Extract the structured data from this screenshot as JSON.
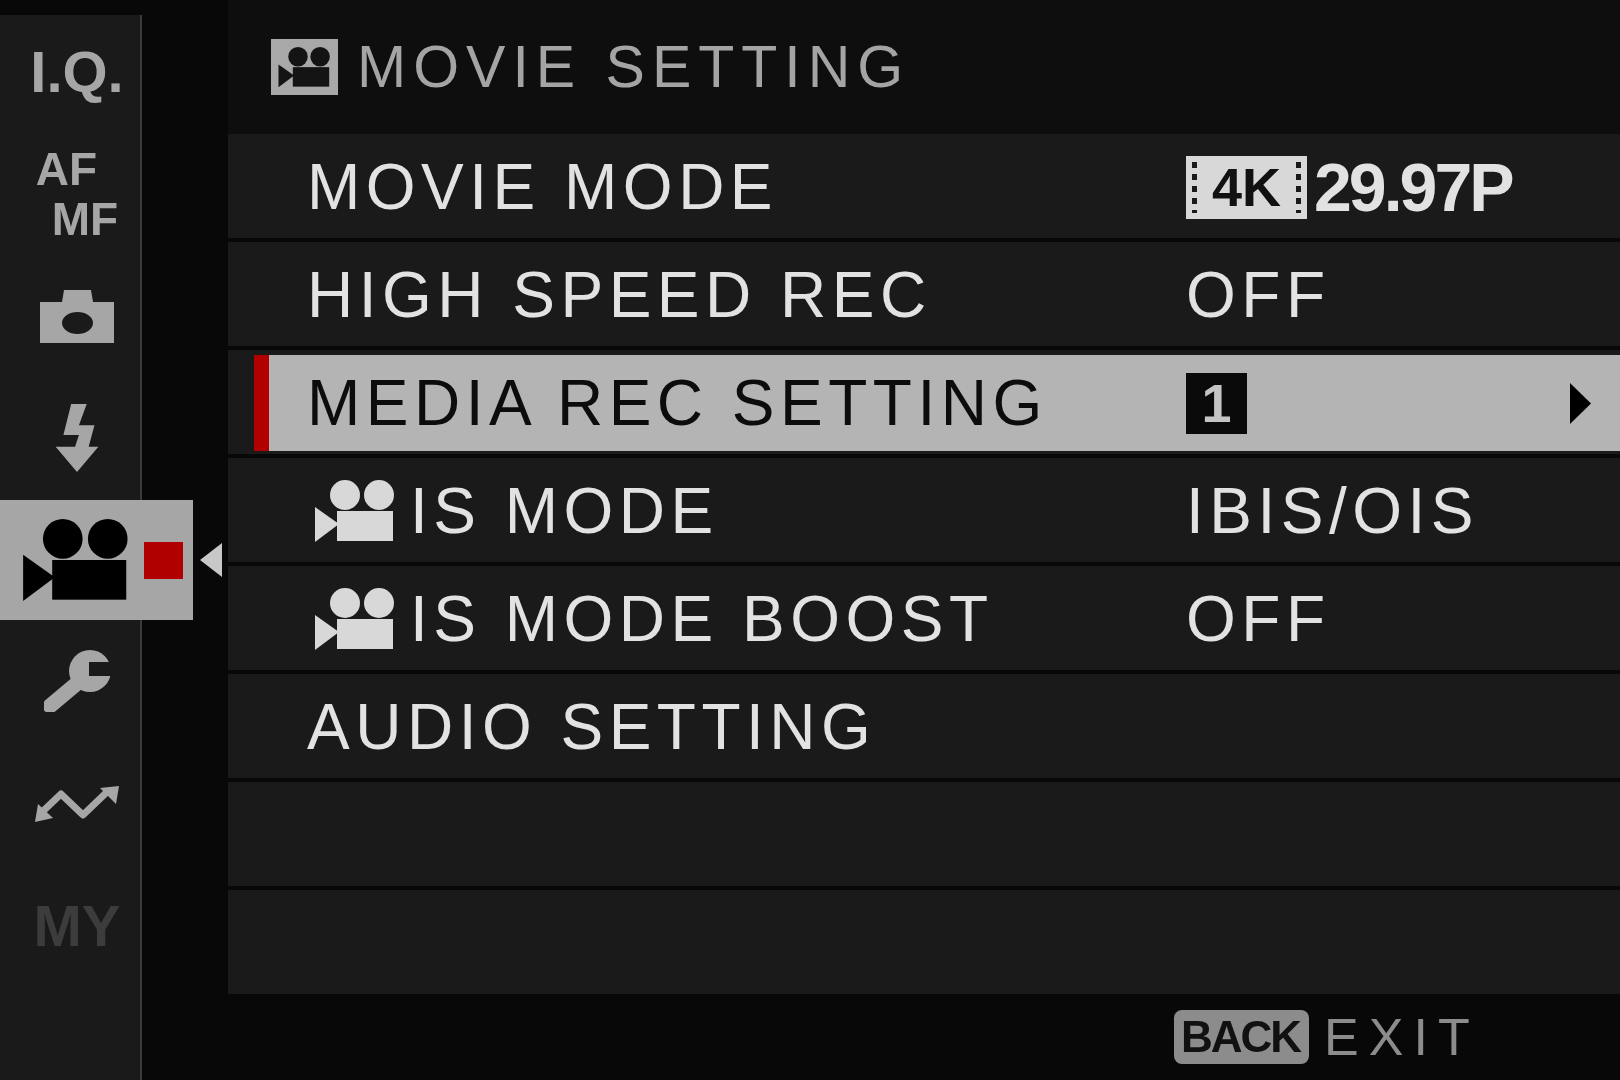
{
  "sidebar": {
    "items": [
      {
        "kind": "text",
        "label": "I.Q.",
        "selected": false,
        "disabled": false
      },
      {
        "kind": "stack",
        "label": "AF",
        "sublabel": "MF",
        "selected": false,
        "disabled": false
      },
      {
        "kind": "icon",
        "selected": false,
        "disabled": false
      },
      {
        "kind": "icon",
        "selected": false,
        "disabled": false
      },
      {
        "kind": "icon",
        "selected": true,
        "disabled": false
      },
      {
        "kind": "icon",
        "selected": false,
        "disabled": false
      },
      {
        "kind": "icon",
        "selected": false,
        "disabled": false
      },
      {
        "kind": "text",
        "label": "MY",
        "selected": false,
        "disabled": true
      }
    ]
  },
  "header": {
    "title": "MOVIE SETTING"
  },
  "menu": {
    "rows": [
      {
        "label": "MOVIE MODE",
        "kind": "plain",
        "selected": false,
        "value": {
          "kind": "format",
          "badge": "4K",
          "text": "29.97P"
        }
      },
      {
        "label": "HIGH SPEED REC",
        "kind": "plain",
        "selected": false,
        "value": {
          "kind": "text",
          "text": "OFF"
        }
      },
      {
        "label": "MEDIA REC SETTING",
        "kind": "plain",
        "selected": true,
        "value": {
          "kind": "boxed",
          "text": "1"
        }
      },
      {
        "label": "IS MODE",
        "kind": "prefixed",
        "selected": false,
        "value": {
          "kind": "text",
          "text": "IBIS/OIS"
        }
      },
      {
        "label": "IS MODE BOOST",
        "kind": "prefixed",
        "selected": false,
        "value": {
          "kind": "text",
          "text": "OFF"
        }
      },
      {
        "label": "AUDIO SETTING",
        "kind": "plain",
        "selected": false
      }
    ]
  },
  "footer": {
    "key": "BACK",
    "action": "EXIT"
  }
}
